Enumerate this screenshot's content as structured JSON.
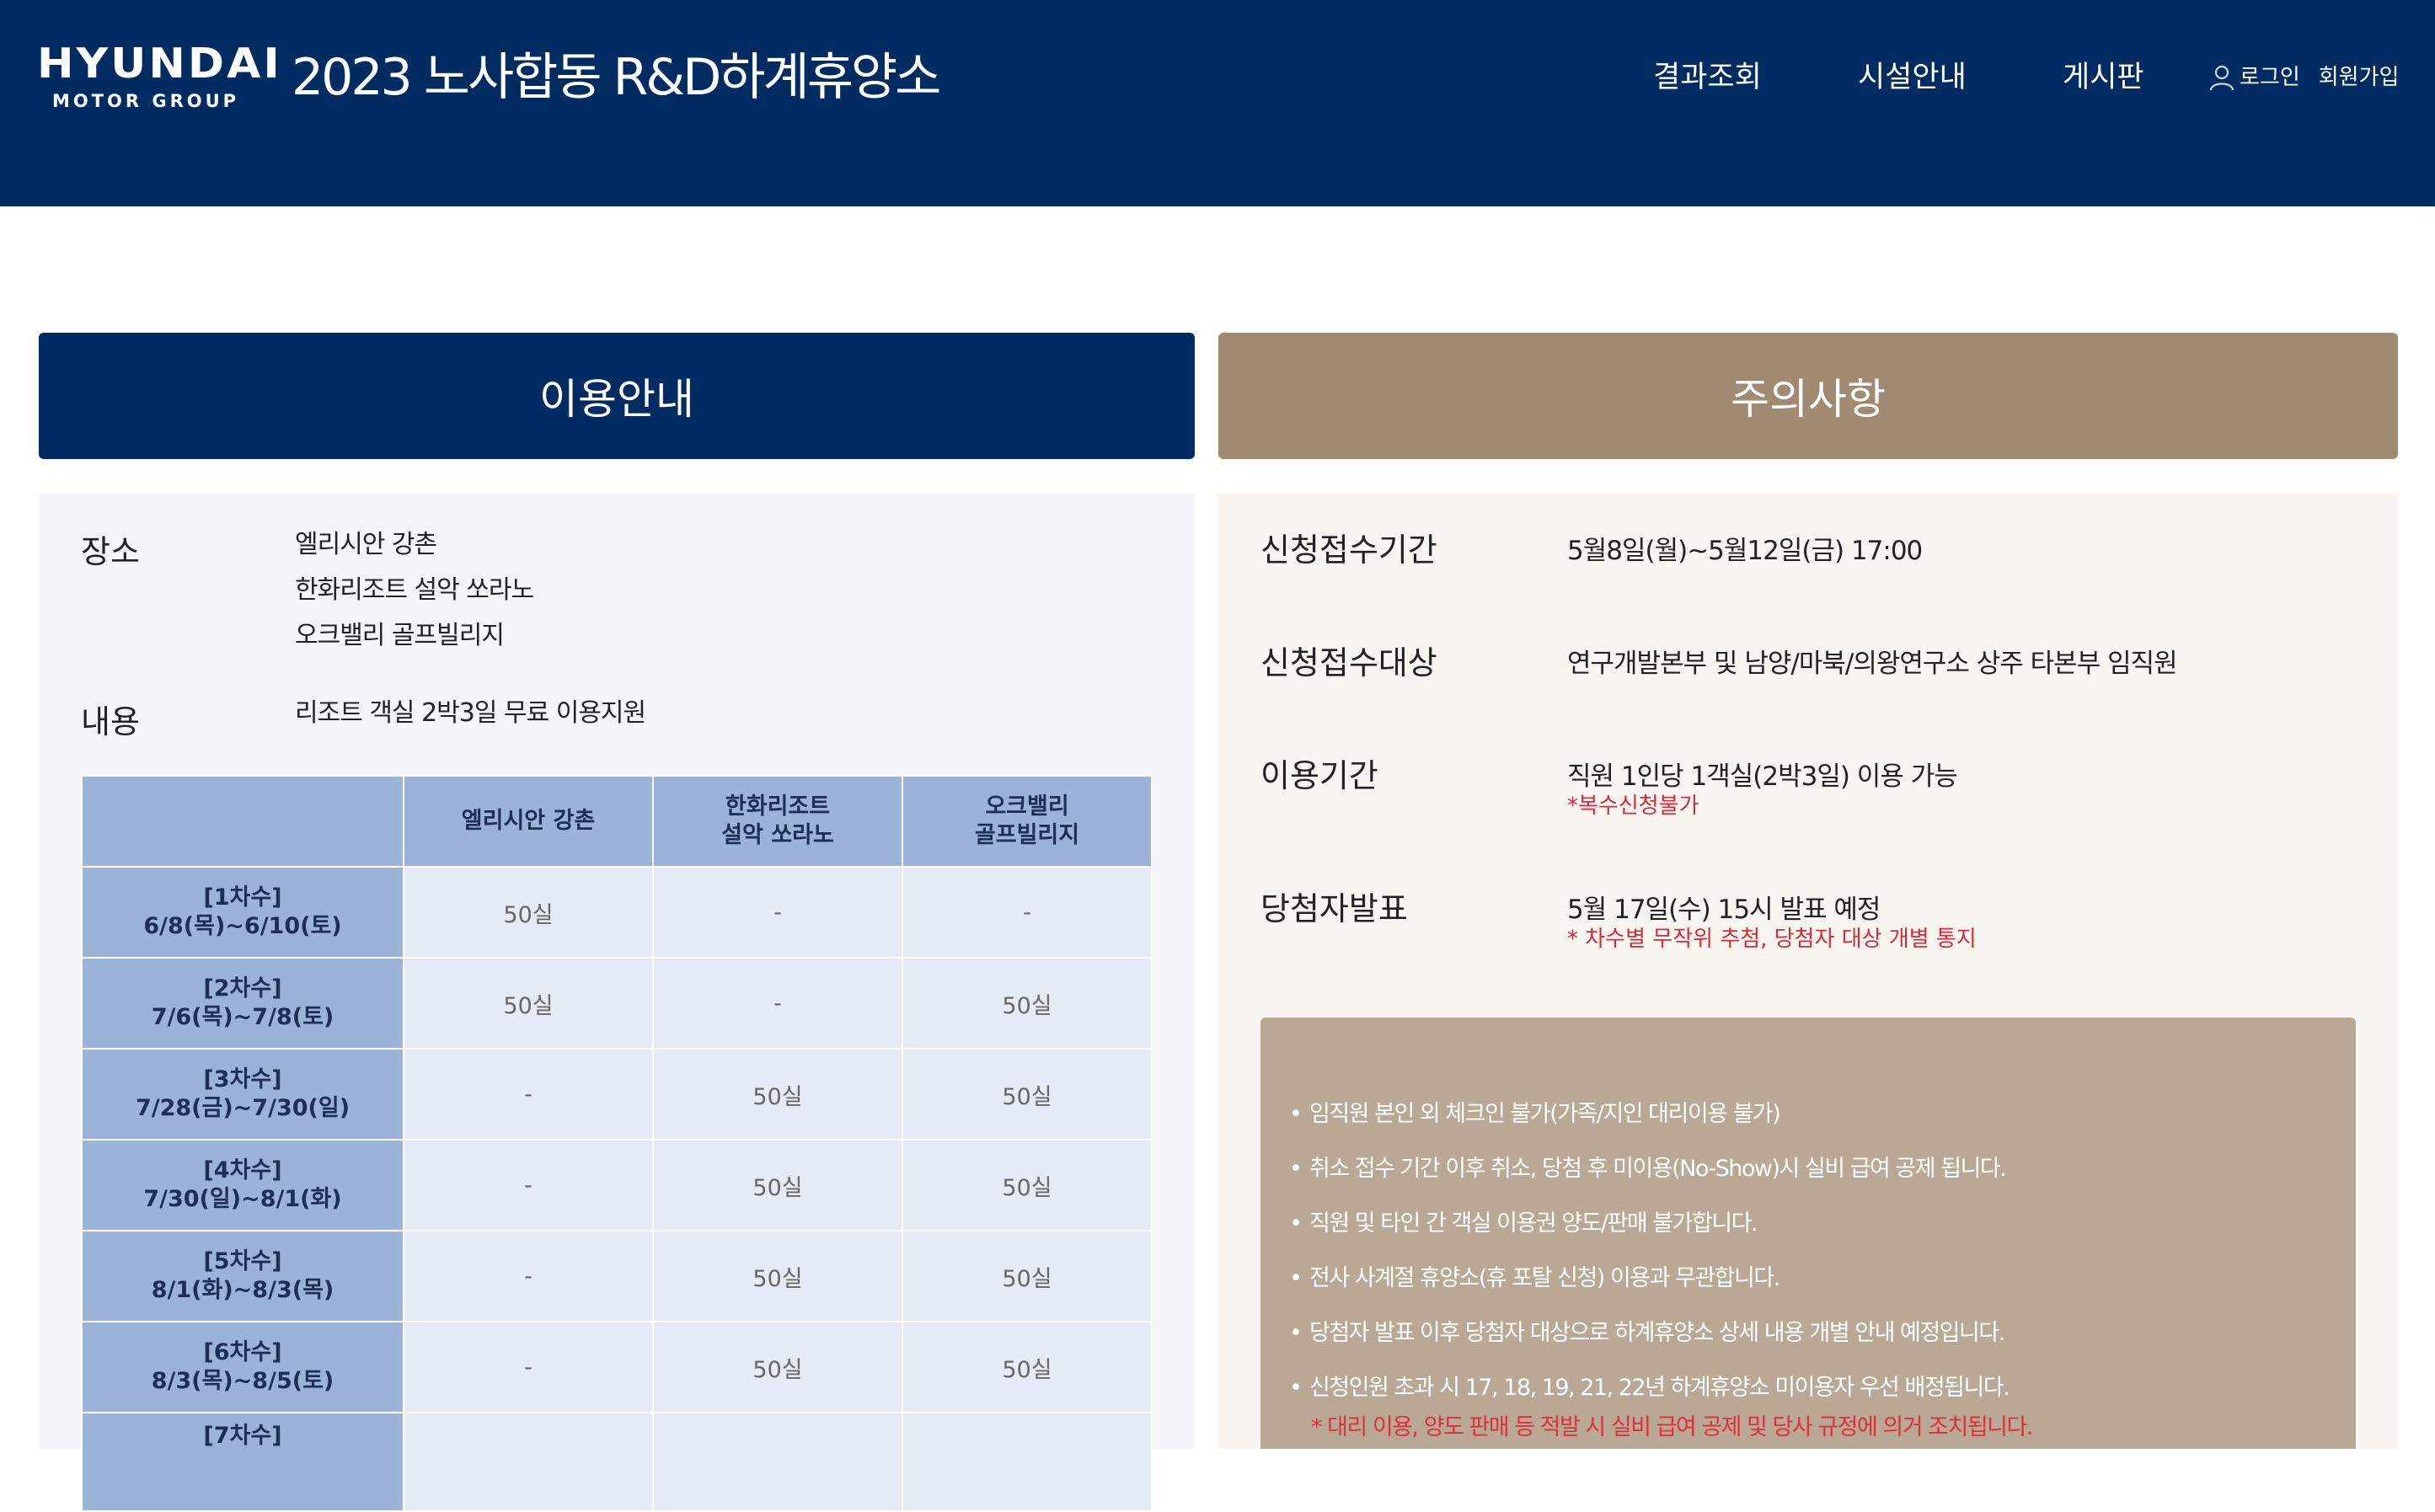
{
  "header": {
    "logo_main": "HYUNDAI",
    "logo_sub": "MOTOR GROUP",
    "title": "2023 노사합동 R&D하계휴양소",
    "nav": [
      "결과조회",
      "시설안내",
      "게시판"
    ],
    "login": "로그인",
    "signup": "회원가입"
  },
  "usage": {
    "heading": "이용안내",
    "place_label": "장소",
    "places": [
      "엘리시안 강촌",
      "한화리조트 설악 쏘라노",
      "오크밸리 골프빌리지"
    ],
    "content_label": "내용",
    "content": "리조트 객실 2박3일 무료 이용지원",
    "table": {
      "columns": [
        "",
        "엘리시안 강촌",
        "한화리조트",
        "설악 쏘라노",
        "오크밸리",
        "골프빌리지"
      ],
      "rows": [
        {
          "round": "[1차수]",
          "dates": "6/8(목)~6/10(토)",
          "cells": [
            "50실",
            "-",
            "-"
          ]
        },
        {
          "round": "[2차수]",
          "dates": "7/6(목)~7/8(토)",
          "cells": [
            "50실",
            "-",
            "50실"
          ]
        },
        {
          "round": "[3차수]",
          "dates": "7/28(금)~7/30(일)",
          "cells": [
            "-",
            "50실",
            "50실"
          ]
        },
        {
          "round": "[4차수]",
          "dates": "7/30(일)~8/1(화)",
          "cells": [
            "-",
            "50실",
            "50실"
          ]
        },
        {
          "round": "[5차수]",
          "dates": "8/1(화)~8/3(목)",
          "cells": [
            "-",
            "50실",
            "50실"
          ]
        },
        {
          "round": "[6차수]",
          "dates": "8/3(목)~8/5(토)",
          "cells": [
            "-",
            "50실",
            "50실"
          ]
        },
        {
          "round": "[7차수]",
          "dates": "",
          "cells": [
            "",
            "",
            ""
          ]
        }
      ]
    }
  },
  "notice": {
    "heading": "주의사항",
    "apply_period_label": "신청접수기간",
    "apply_period": "5월8일(월)~5월12일(금) 17:00",
    "apply_target_label": "신청접수대상",
    "apply_target": "연구개발본부 및 남양/마북/의왕연구소 상주 타본부 임직원",
    "use_period_label": "이용기간",
    "use_period": "직원 1인당 1객실(2박3일) 이용 가능",
    "use_period_note": "*복수신청불가",
    "winner_label": "당첨자발표",
    "winner": "5월 17일(수) 15시 발표 예정",
    "winner_note": "* 차수별 무작위 추첨, 당첨자 대상 개별 통지",
    "items": [
      "임직원 본인 외 체크인 불가(가족/지인 대리이용 불가)",
      "취소 접수 기간 이후 취소, 당첨 후 미이용(No-Show)시 실비 급여 공제 됩니다.",
      "직원 및 타인 간 객실 이용권 양도/판매 불가합니다.",
      "전사 사계절 휴양소(휴 포탈 신청) 이용과 무관합니다.",
      "당첨자 발표 이후 당첨자 대상으로 하계휴양소 상세 내용 개별 안내 예정입니다.",
      "신청인원 초과 시 17, 18, 19, 21, 22년 하계휴양소 미이용자 우선 배정됩니다."
    ],
    "red_note": "* 대리 이용, 양도 판매 등 적발 시 실비 급여 공제 및 당사 규정에 의거 조치됩니다."
  }
}
